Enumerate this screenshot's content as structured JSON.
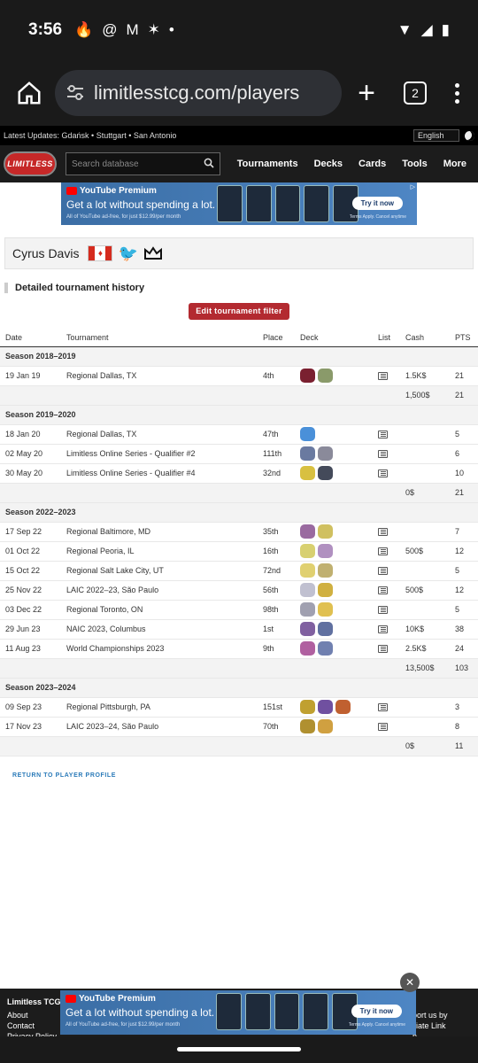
{
  "statusbar": {
    "time": "3:56"
  },
  "browser": {
    "url": "limitlesstcg.com/players",
    "tab_count": "2"
  },
  "updates": {
    "text": "Latest Updates: Gdańsk • Stuttgart • San Antonio",
    "language": "English"
  },
  "site": {
    "logo": "LIMITLESS",
    "search_placeholder": "Search database",
    "nav": [
      "Tournaments",
      "Decks",
      "Cards",
      "Tools",
      "More"
    ]
  },
  "ad": {
    "brand": "YouTube Premium",
    "headline": "Get a lot without spending a lot.",
    "fine": "All of YouTube ad-free, for just $12.99/per month",
    "cta": "Try it now",
    "terms": "Terms Apply. Cancel anytime"
  },
  "player": {
    "name": "Cyrus Davis"
  },
  "section": {
    "title": "Detailed tournament history",
    "filter_button": "Edit tournament filter"
  },
  "table": {
    "headers": [
      "Date",
      "Tournament",
      "Place",
      "Deck",
      "List",
      "Cash",
      "PTS"
    ],
    "seasons": [
      {
        "label": "Season 2018–2019",
        "rows": [
          {
            "date": "19 Jan 19",
            "tournament": "Regional Dallas, TX",
            "place": "4th",
            "cash": "1.5K$",
            "pts": "21",
            "deck": [
              "#7a2030",
              "#8a9a6a"
            ]
          }
        ],
        "total_cash": "1,500$",
        "total_pts": "21"
      },
      {
        "label": "Season 2019–2020",
        "rows": [
          {
            "date": "18 Jan 20",
            "tournament": "Regional Dallas, TX",
            "place": "47th",
            "cash": "",
            "pts": "5",
            "deck": [
              "#4a90d9"
            ]
          },
          {
            "date": "02 May 20",
            "tournament": "Limitless Online Series - Qualifier #2",
            "place": "111th",
            "cash": "",
            "pts": "6",
            "deck": [
              "#6a7aa0",
              "#8a8a9a"
            ]
          },
          {
            "date": "30 May 20",
            "tournament": "Limitless Online Series - Qualifier #4",
            "place": "32nd",
            "cash": "",
            "pts": "10",
            "deck": [
              "#d8c040",
              "#444a5a"
            ]
          }
        ],
        "total_cash": "0$",
        "total_pts": "21"
      },
      {
        "label": "Season 2022–2023",
        "rows": [
          {
            "date": "17 Sep 22",
            "tournament": "Regional Baltimore, MD",
            "place": "35th",
            "cash": "",
            "pts": "7",
            "deck": [
              "#9a6aa0",
              "#d0c060"
            ]
          },
          {
            "date": "01 Oct 22",
            "tournament": "Regional Peoria, IL",
            "place": "16th",
            "cash": "500$",
            "pts": "12",
            "deck": [
              "#d8d070",
              "#b090c0"
            ]
          },
          {
            "date": "15 Oct 22",
            "tournament": "Regional Salt Lake City, UT",
            "place": "72nd",
            "cash": "",
            "pts": "5",
            "deck": [
              "#e0d070",
              "#c0b070"
            ]
          },
          {
            "date": "25 Nov 22",
            "tournament": "LAIC 2022–23, São Paulo",
            "place": "56th",
            "cash": "500$",
            "pts": "12",
            "deck": [
              "#c0c0d0",
              "#d0b040"
            ]
          },
          {
            "date": "03 Dec 22",
            "tournament": "Regional Toronto, ON",
            "place": "98th",
            "cash": "",
            "pts": "5",
            "deck": [
              "#a0a0b0",
              "#e0c050"
            ]
          },
          {
            "date": "29 Jun 23",
            "tournament": "NAIC 2023, Columbus",
            "place": "1st",
            "cash": "10K$",
            "pts": "38",
            "deck": [
              "#8060a0",
              "#6070a0"
            ]
          },
          {
            "date": "11 Aug 23",
            "tournament": "World Championships 2023",
            "place": "9th",
            "cash": "2.5K$",
            "pts": "24",
            "deck": [
              "#b060a0",
              "#7080b0"
            ]
          }
        ],
        "total_cash": "13,500$",
        "total_pts": "103"
      },
      {
        "label": "Season 2023–2024",
        "rows": [
          {
            "date": "09 Sep 23",
            "tournament": "Regional Pittsburgh, PA",
            "place": "151st",
            "cash": "",
            "pts": "3",
            "deck": [
              "#c0a030",
              "#7050a0",
              "#c06030"
            ]
          },
          {
            "date": "17 Nov 23",
            "tournament": "LAIC 2023–24, São Paulo",
            "place": "70th",
            "cash": "",
            "pts": "8",
            "deck": [
              "#b09030",
              "#d0a040"
            ]
          }
        ],
        "total_cash": "0$",
        "total_pts": "11"
      }
    ]
  },
  "return_link": "RETURN TO PLAYER PROFILE",
  "footer": {
    "brand": "Limitless TCG",
    "left": [
      "About",
      "Contact",
      "Privacy Policy"
    ],
    "right": [
      "port us by",
      "iliate Link",
      "n"
    ]
  }
}
